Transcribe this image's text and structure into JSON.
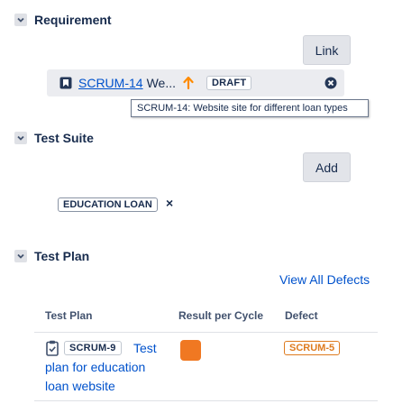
{
  "requirement": {
    "title": "Requirement",
    "link_button": "Link",
    "issue_key": "SCRUM-14",
    "issue_summary_truncated": "We...",
    "status": "DRAFT",
    "tooltip": "SCRUM-14: Website site for different loan types"
  },
  "test_suite": {
    "title": "Test Suite",
    "add_button": "Add",
    "tag": "EDUCATION LOAN",
    "tag_remove": "×"
  },
  "test_plan": {
    "title": "Test Plan",
    "view_all": "View All Defects",
    "columns": [
      "Test Plan",
      "Result per Cycle",
      "Defect"
    ],
    "rows": [
      {
        "key": "SCRUM-9",
        "title_lines": [
          "Test",
          "plan for education",
          "loan website"
        ],
        "result_color": "#f07822",
        "defect": "SCRUM-5"
      }
    ]
  },
  "colors": {
    "link": "#0052cc",
    "priority_high": "#ff8b00",
    "defect": "#de7b1f",
    "result": "#f07822"
  }
}
